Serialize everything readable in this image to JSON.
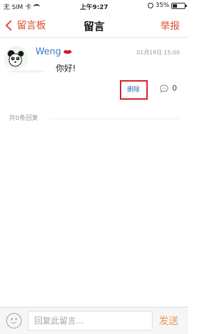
{
  "status_bar": {
    "carrier": "无 SIM 卡",
    "time": "上午9:27",
    "battery": "35%",
    "battery_level": 0.35,
    "icons": [
      "wifi-icon",
      "orientation-lock-icon",
      "battery-icon"
    ]
  },
  "nav": {
    "back_label": "留言板",
    "title": "留言",
    "report_label": "举报",
    "accent_color": "#e04b33"
  },
  "message": {
    "username": "Weng",
    "username_color": "#3b7fc4",
    "badge_icon": "lips-icon",
    "timestamp": "01月19日 15:00",
    "content": "你好!",
    "delete_label": "删除",
    "comment_icon": "comment-bubble-icon",
    "comment_count": "0",
    "highlight_color": "#d3232d"
  },
  "replies": {
    "count_label": "共0条回复"
  },
  "bottom_bar": {
    "emoji_icon": "smiley-icon",
    "input_placeholder": "回复此留言...",
    "input_value": "",
    "send_label": "发送",
    "send_color": "#f0964a"
  }
}
